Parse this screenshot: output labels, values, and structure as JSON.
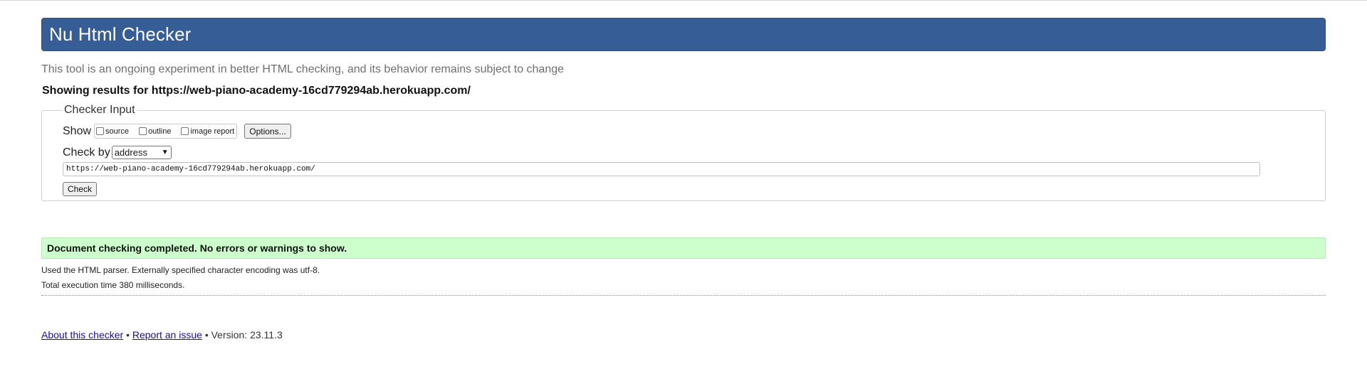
{
  "header": {
    "title": "Nu Html Checker"
  },
  "intro": "This tool is an ongoing experiment in better HTML checking, and its behavior remains subject to change",
  "showing": "Showing results for https://web-piano-academy-16cd779294ab.herokuapp.com/",
  "checker_input": {
    "legend": "Checker Input",
    "show_label": "Show",
    "options": [
      {
        "label": "source",
        "checked": false
      },
      {
        "label": "outline",
        "checked": false
      },
      {
        "label": "image report",
        "checked": false
      }
    ],
    "options_button": "Options...",
    "check_by_label": "Check by",
    "check_by_value": "address",
    "url_value": "https://web-piano-academy-16cd779294ab.herokuapp.com/",
    "check_button": "Check"
  },
  "results": {
    "status": "Document checking completed. No errors or warnings to show.",
    "parser_note": "Used the HTML parser. Externally specified character encoding was utf-8.",
    "execution_time": "Total execution time 380 milliseconds."
  },
  "footer": {
    "about_link": "About this checker",
    "separator": "•",
    "report_link": "Report an issue",
    "version": "Version: 23.11.3"
  },
  "colors": {
    "header_bg": "#365d95",
    "success_bg": "#ccffcc",
    "link": "#1a0dab"
  }
}
